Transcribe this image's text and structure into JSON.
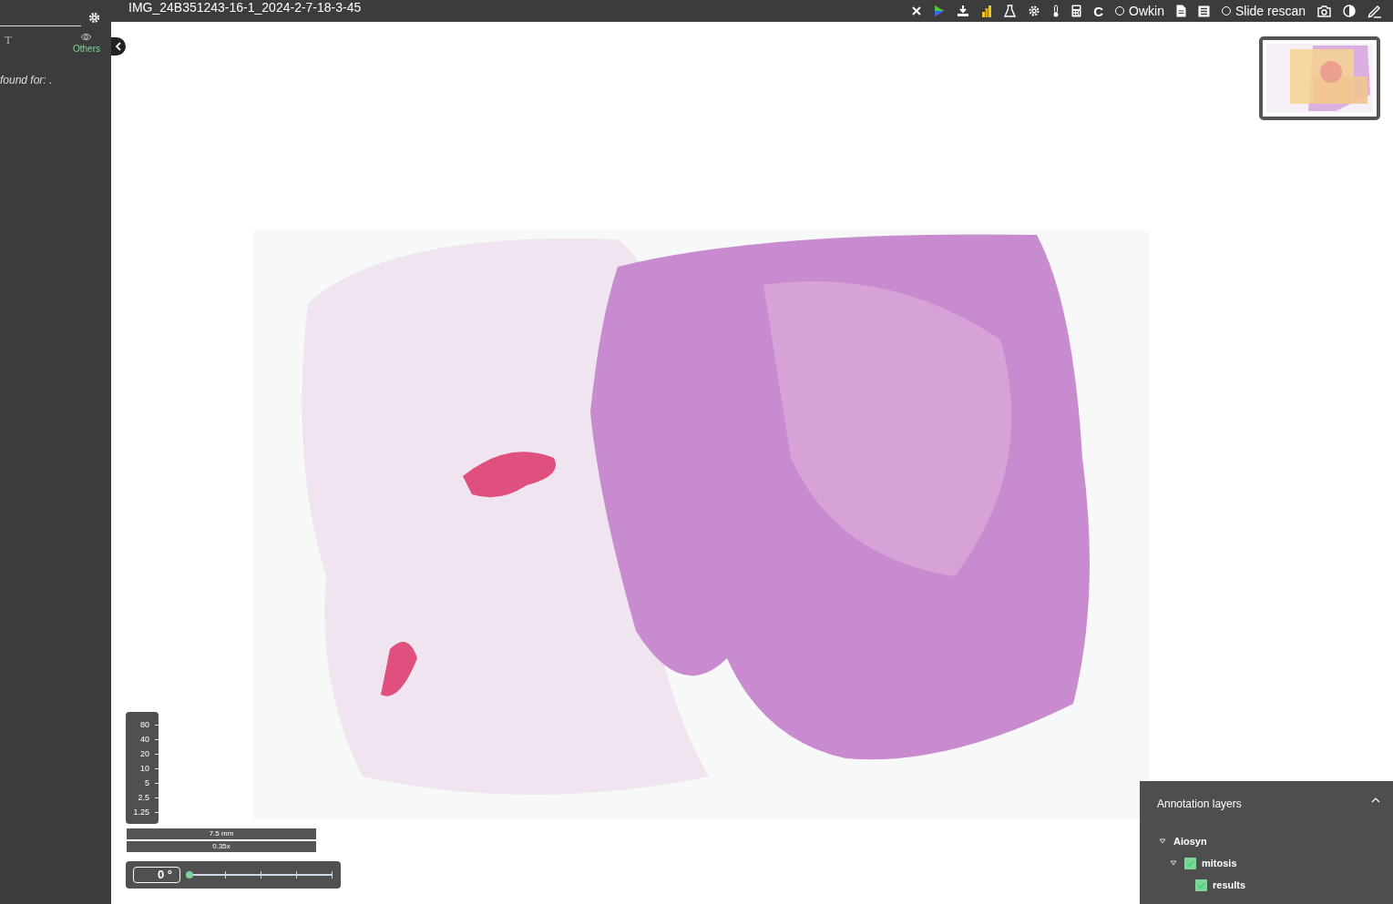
{
  "sidebar": {
    "text_tool": "T",
    "filter": {
      "label": "Others",
      "selected": true
    },
    "message": "found for: ."
  },
  "window": {
    "title": "IMG_24B351243-16-1_2024-2-7-18-3-45"
  },
  "toolbar": [
    {
      "kind": "icon"
    },
    {
      "kind": "icon"
    },
    {
      "kind": "icon"
    },
    {
      "kind": "icon"
    },
    {
      "kind": "icon"
    },
    {
      "kind": "icon"
    },
    {
      "kind": "icon"
    },
    {
      "kind": "icon"
    },
    {
      "kind": "glyph",
      "text": "C"
    },
    {
      "kind": "radio",
      "label": "Owkin",
      "selected": false
    },
    {
      "kind": "icon"
    },
    {
      "kind": "icon"
    },
    {
      "kind": "radio",
      "label": "Slide rescan",
      "selected": false
    },
    {
      "kind": "icon"
    },
    {
      "kind": "icon"
    },
    {
      "kind": "icon"
    }
  ],
  "zoom_levels": [
    "80",
    "40",
    "20",
    "10",
    "5",
    "2.5",
    "1.25"
  ],
  "scale": {
    "length": "7.5 mm",
    "magnification": "0.35x"
  },
  "rotation": {
    "value": "0 °",
    "level": 0
  },
  "annotation_layers": {
    "title": "Annotation layers",
    "expanded": true,
    "tree": [
      {
        "label": "Aiosyn",
        "expanded": true,
        "children": [
          {
            "label": "mitosis",
            "checked": true,
            "expanded": true,
            "children": [
              {
                "label": "results",
                "checked": true
              }
            ]
          }
        ]
      }
    ]
  }
}
